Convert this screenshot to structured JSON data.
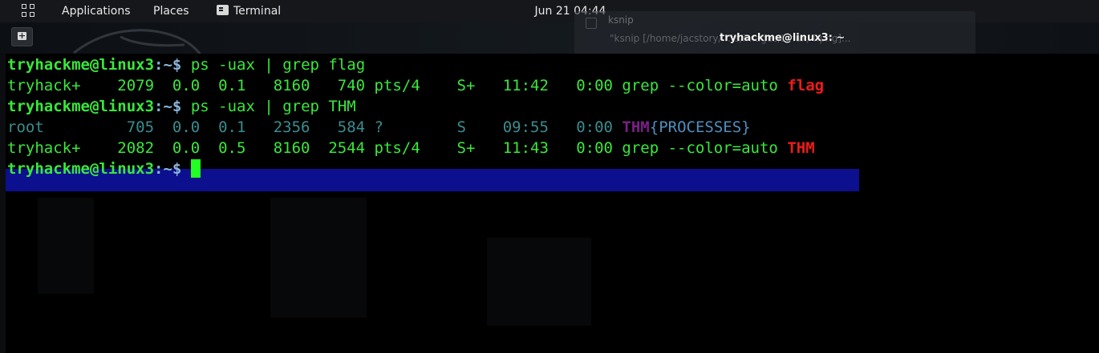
{
  "topbar": {
    "applications": "Applications",
    "places": "Places",
    "terminal": "Terminal",
    "clock": "Jun 21  04:44"
  },
  "notification": {
    "title": "ksnip",
    "body": "\"ksnip [/home/jacstory/...ts/images/Linux/4.png]..."
  },
  "window": {
    "title": "tryhackme@linux3: ~"
  },
  "terminal": {
    "prompt_user": "tryhackme@linux3",
    "prompt_colon": ":",
    "prompt_dir": "~$ ",
    "lines": [
      {
        "cmd": "ps -uax | grep flag"
      },
      {
        "out": "tryhack+    2079  0.0  0.1   8160   740 pts/4    S+   11:42   0:00 grep --color=auto ",
        "match": "flag"
      },
      {
        "cmd": "ps -uax | grep THM"
      },
      {
        "out": "root         705  0.0  0.1   2356   584 ?        S    09:55   0:00 ",
        "match": "THM",
        "rest": "{PROCESSES}"
      },
      {
        "out": "tryhack+    2082  0.0  0.5   8160  2544 pts/4    S+   11:43   0:00 grep --color=auto ",
        "match": "THM"
      }
    ]
  },
  "colors": {
    "prompt_green": "#39e83b",
    "match_red": "#ef1a1a",
    "selection_blue": "#0c0f8e",
    "cursor": "#22ff22"
  }
}
